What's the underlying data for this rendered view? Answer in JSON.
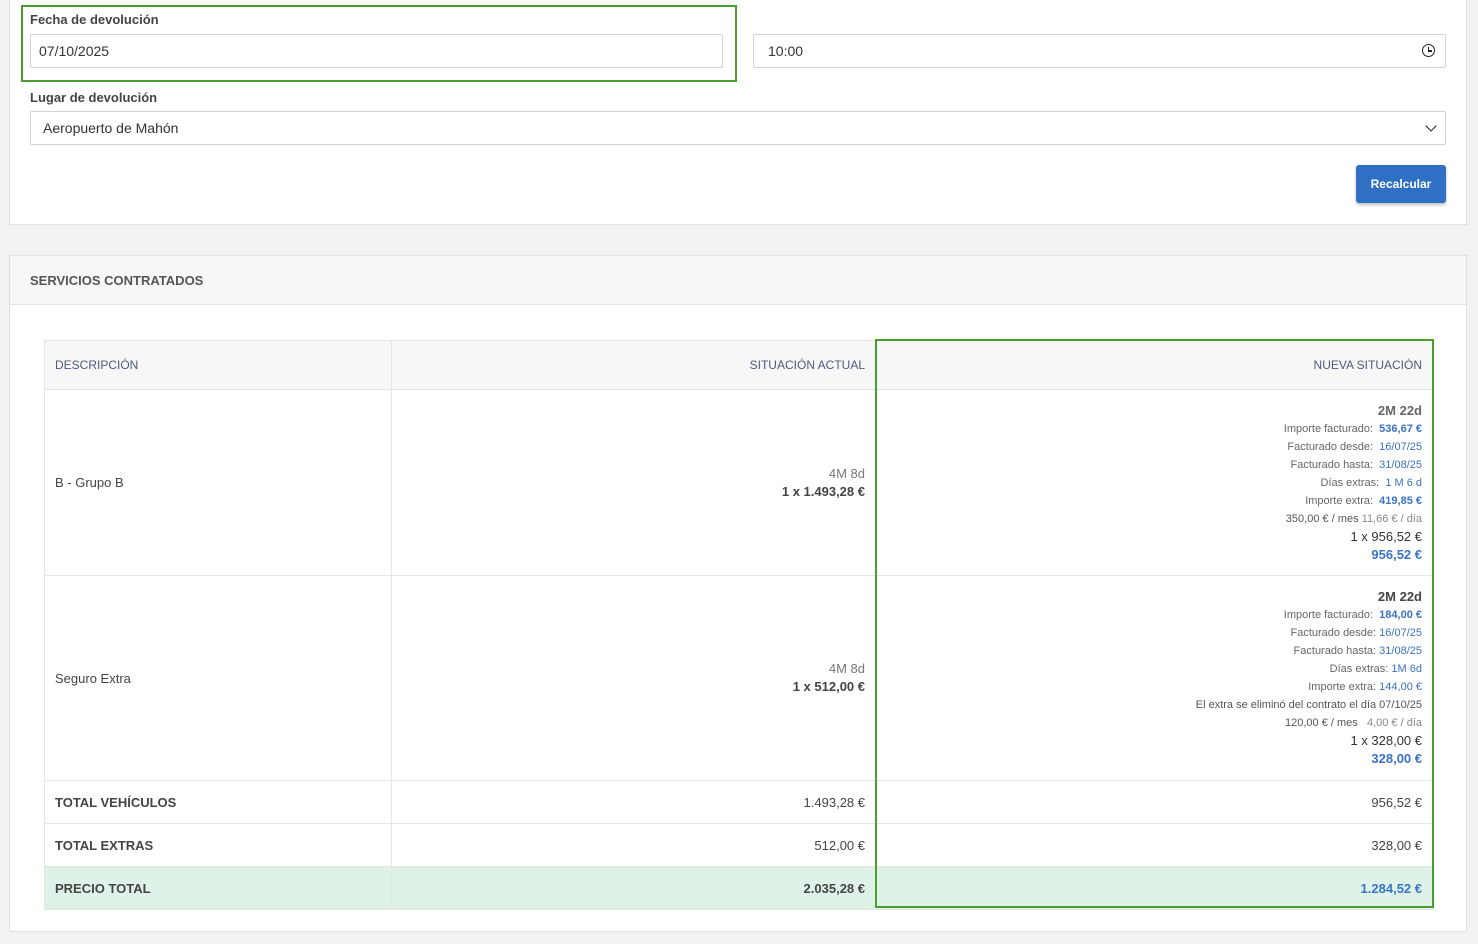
{
  "return_form": {
    "date_label": "Fecha de devolución",
    "date_value": "07/10/2025",
    "time_value": "10:00",
    "place_label": "Lugar de devolución",
    "place_value": "Aeropuerto de Mahón",
    "recalc_button": "Recalcular"
  },
  "services": {
    "header": "SERVICIOS CONTRATADOS",
    "columns": [
      "DESCRIPCIÓN",
      "SITUACIÓN ACTUAL",
      "NUEVA SITUACIÓN"
    ],
    "rows": [
      {
        "description": "B - Grupo B",
        "current_duration": "4M 8d",
        "current_amount": "1 x 1.493,28 €",
        "new_duration": "2M 22d",
        "invoiced_label": "Importe facturado:",
        "invoiced_value": "536,67 €",
        "from_label": "Facturado desde:",
        "from_value": "16/07/25",
        "to_label": "Facturado hasta:",
        "to_value": "31/08/25",
        "extra_days_label": "Días extras:",
        "extra_days_value": "1 M 6 d",
        "extra_amount_label": "Importe extra:",
        "extra_amount_value": "419,85 €",
        "rate_month": "350,00 € / mes",
        "rate_day": "11,66 € / día",
        "new_amount": "1 x 956,52 €",
        "new_total": "956,52 €"
      },
      {
        "description": "Seguro Extra",
        "current_duration": "4M 8d",
        "current_amount": "1 x 512,00 €",
        "new_duration": "2M 22d",
        "invoiced_label": "Importe facturado:",
        "invoiced_value": "184,00 €",
        "from_label": "Facturado desde:",
        "from_value": "16/07/25",
        "to_label": "Facturado hasta:",
        "to_value": "31/08/25",
        "extra_days_label": "Días extras:",
        "extra_days_value": "1M 6d",
        "extra_amount_label": "Importe extra:",
        "extra_amount_value": "144,00 €",
        "note": "El extra se eliminó del contrato el día 07/10/25",
        "rate_month": "120,00 € / mes",
        "rate_day": "4,00 € / día",
        "new_amount": "1 x 328,00 €",
        "new_total": "328,00 €"
      }
    ],
    "totals": [
      {
        "label": "TOTAL VEHÍCULOS",
        "current": "1.493,28 €",
        "new": "956,52 €"
      },
      {
        "label": "TOTAL EXTRAS",
        "current": "512,00 €",
        "new": "328,00 €"
      }
    ],
    "grand_total": {
      "label": "PRECIO TOTAL",
      "current": "2.035,28 €",
      "new": "1.284,52 €"
    }
  },
  "colors": {
    "highlight": "#4a9e2f",
    "accent": "#2f6fc4",
    "total_row": "#def2e7"
  },
  "icons": {
    "time": "clock-icon",
    "select": "chevron-down-icon"
  }
}
